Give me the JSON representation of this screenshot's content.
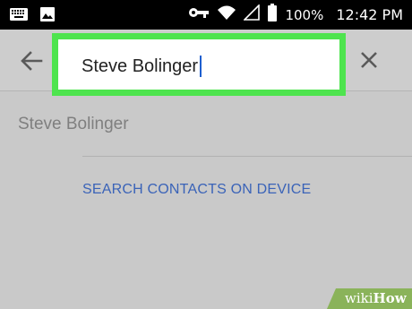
{
  "status_bar": {
    "battery_percent": "100%",
    "time": "12:42 PM",
    "icons": [
      "keyboard-icon",
      "image-icon",
      "key-icon",
      "wifi-icon",
      "no-signal-icon",
      "battery-icon"
    ]
  },
  "app_bar": {
    "back_icon": "arrow-back-icon",
    "search": {
      "value": "Steve Bolinger",
      "highlight_color": "#4ee44e"
    },
    "clear_icon": "close-icon"
  },
  "results": {
    "items": [
      {
        "name": "Steve Bolinger"
      }
    ],
    "search_device_link": "SEARCH CONTACTS ON DEVICE"
  },
  "watermark": {
    "part1": "wiki",
    "part2": "How"
  },
  "colors": {
    "background": "#c9c9c9",
    "link": "#3a63b8",
    "status_bar": "#000000"
  }
}
